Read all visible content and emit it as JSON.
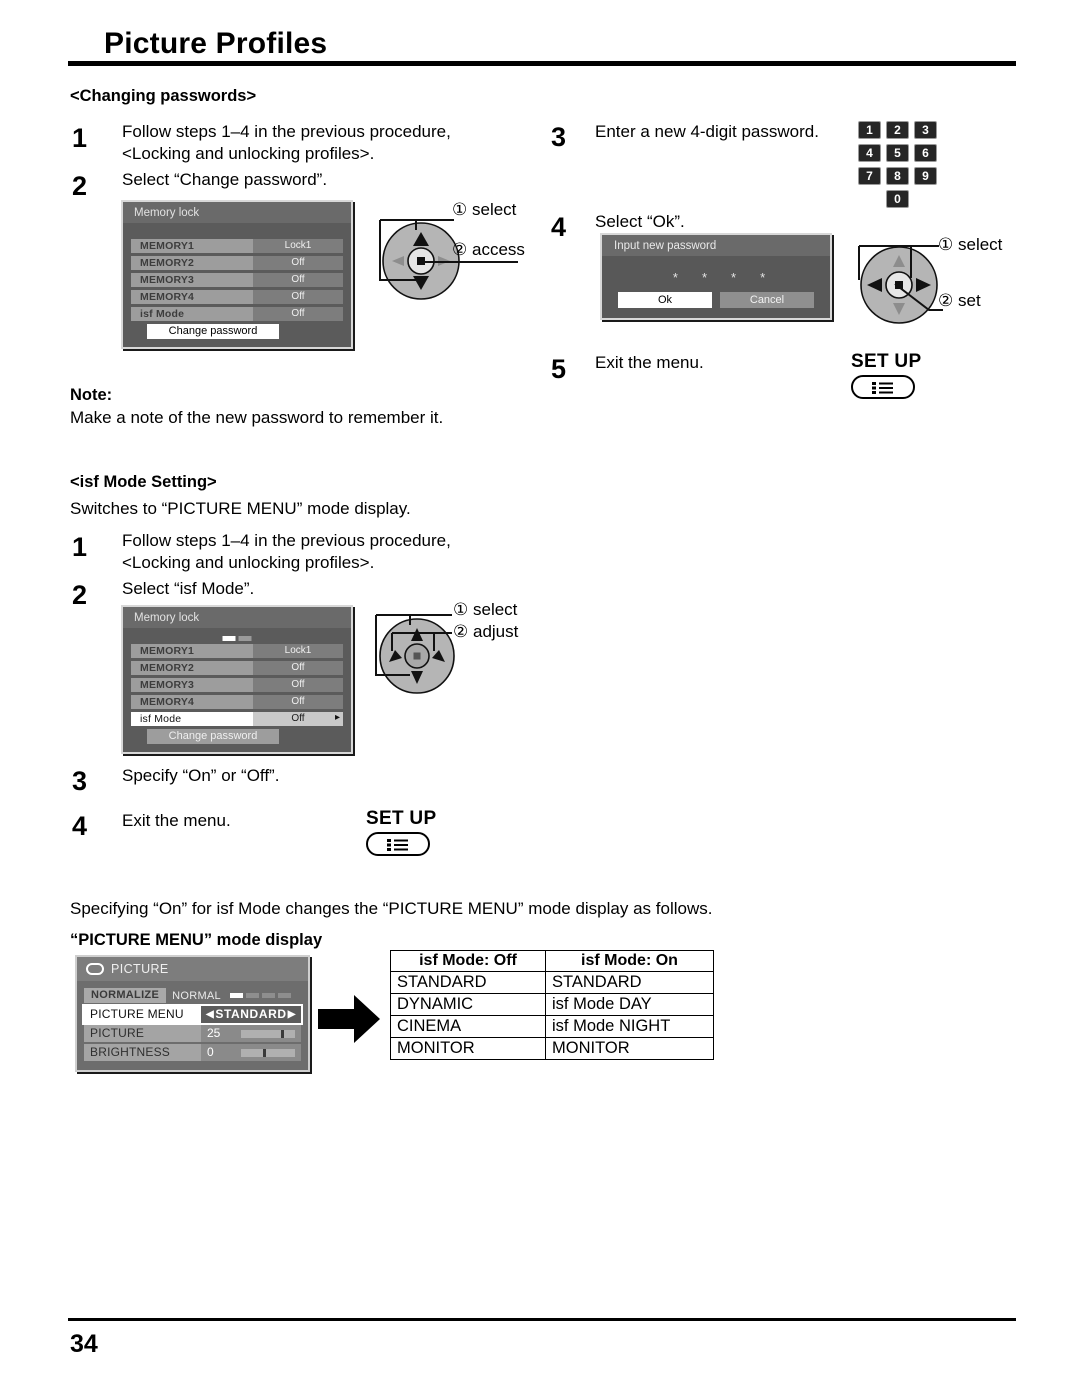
{
  "header": {
    "title": "Picture Profiles"
  },
  "sections": {
    "changing_passwords": {
      "heading": "<Changing passwords>",
      "step1_num": "1",
      "step1_line1": "Follow steps 1–4 in the previous procedure,",
      "step1_line2": "<Locking and unlocking profiles>.",
      "step2_num": "2",
      "step2_text": "Select “Change password”.",
      "step3_num": "3",
      "step3_text": "Enter a new 4-digit password.",
      "step4_num": "4",
      "step4_text": "Select “Ok”.",
      "step5_num": "5",
      "step5_text": "Exit the menu."
    },
    "note": {
      "label": "Note:",
      "text": "Make a note of the new password to remember it."
    },
    "isf_mode_setting": {
      "heading": "<isf Mode Setting>",
      "subtitle": "Switches to “PICTURE MENU” mode display.",
      "step1_num": "1",
      "step1_line1": "Follow steps 1–4 in the previous procedure,",
      "step1_line2": "<Locking and unlocking profiles>.",
      "step2_num": "2",
      "step2_text": "Select “isf Mode”.",
      "step3_num": "3",
      "step3_text": "Specify “On” or “Off”.",
      "step4_num": "4",
      "step4_text": "Exit the menu."
    },
    "picture_menu_intro": "Specifying “On” for isf Mode changes the “PICTURE MENU” mode display as follows.",
    "picture_menu_heading": "“PICTURE MENU” mode display"
  },
  "osd_memory_lock_1": {
    "title": "Memory lock",
    "rows": [
      {
        "label": "MEMORY1",
        "value": "Lock1"
      },
      {
        "label": "MEMORY2",
        "value": "Off"
      },
      {
        "label": "MEMORY3",
        "value": "Off"
      },
      {
        "label": "MEMORY4",
        "value": "Off"
      },
      {
        "label": "isf Mode",
        "value": "Off"
      }
    ],
    "button": "Change password"
  },
  "osd_memory_lock_2": {
    "title": "Memory lock",
    "rows": [
      {
        "label": "MEMORY1",
        "value": "Lock1"
      },
      {
        "label": "MEMORY2",
        "value": "Off"
      },
      {
        "label": "MEMORY3",
        "value": "Off"
      },
      {
        "label": "MEMORY4",
        "value": "Off"
      },
      {
        "label": "isf Mode",
        "value": "Off"
      }
    ],
    "button": "Change password"
  },
  "password_dialog": {
    "title": "Input new password",
    "stars": [
      "*",
      "*",
      "*",
      "*"
    ],
    "ok_label": "Ok",
    "cancel_label": "Cancel"
  },
  "dial_access": {
    "callout1_num": "①",
    "callout1": "select",
    "callout2_num": "②",
    "callout2": "access"
  },
  "dial_set": {
    "callout1_num": "①",
    "callout1": "select",
    "callout2_num": "②",
    "callout2": "set"
  },
  "dial_adjust": {
    "callout1_num": "①",
    "callout1": "select",
    "callout2_num": "②",
    "callout2": "adjust"
  },
  "keypad": {
    "keys": [
      "1",
      "2",
      "3",
      "4",
      "5",
      "6",
      "7",
      "8",
      "9",
      "0"
    ]
  },
  "setup_button_1": {
    "label": "SET UP"
  },
  "setup_button_2": {
    "label": "SET UP"
  },
  "picture_osd": {
    "title": "PICTURE",
    "normalize": "NORMALIZE",
    "normal": "NORMAL",
    "rows": [
      {
        "label": "PICTURE MENU",
        "value": "STANDARD"
      },
      {
        "label": "PICTURE",
        "value": "25"
      },
      {
        "label": "BRIGHTNESS",
        "value": "0"
      }
    ]
  },
  "comparison_table": {
    "headers": [
      "isf Mode: Off",
      "isf Mode: On"
    ],
    "rows": [
      [
        "STANDARD",
        "STANDARD"
      ],
      [
        "DYNAMIC",
        "isf Mode DAY"
      ],
      [
        "CINEMA",
        "isf Mode NIGHT"
      ],
      [
        "MONITOR",
        "MONITOR"
      ]
    ]
  },
  "footer": {
    "page_number": "34"
  },
  "colors": {
    "accent": "#000000",
    "osd_bg": "#5b5b5b",
    "osd_highlight": "#ffffff"
  }
}
